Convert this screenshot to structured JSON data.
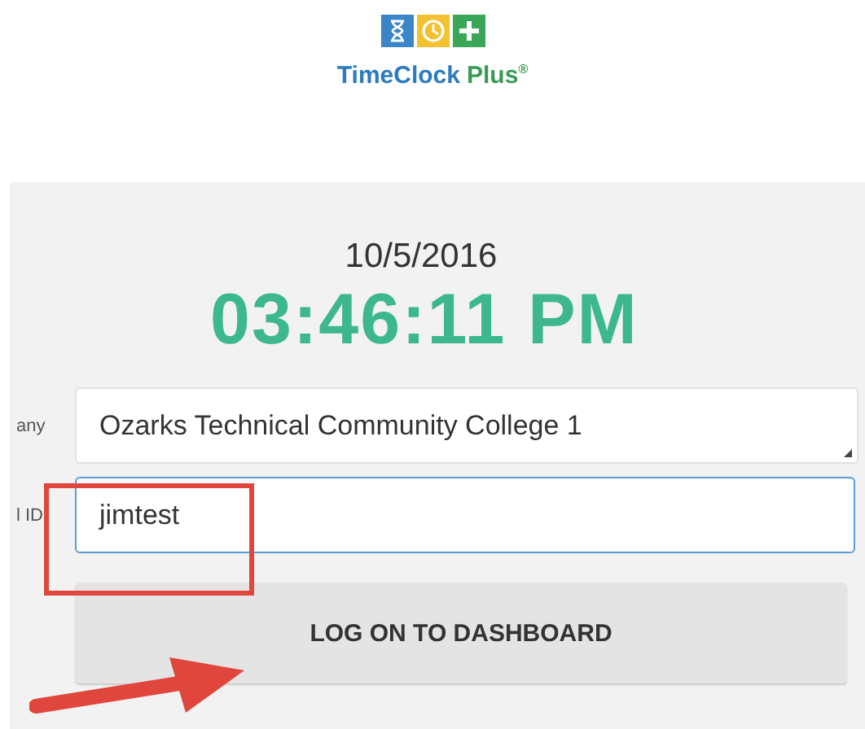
{
  "logo": {
    "name": "TimeClock",
    "suffix": "Plus",
    "registered": "®"
  },
  "date": "10/5/2016",
  "time": "03:46:11 PM",
  "fields": [
    {
      "kind": "select",
      "label": "any",
      "value": "Ozarks Technical Community College  1",
      "focused": false
    },
    {
      "kind": "input",
      "label": "l ID",
      "value": "jimtest",
      "focused": true
    }
  ],
  "button": "LOG ON TO DASHBOARD",
  "annotations": [
    {
      "kind": "box"
    },
    {
      "kind": "arrow"
    }
  ]
}
